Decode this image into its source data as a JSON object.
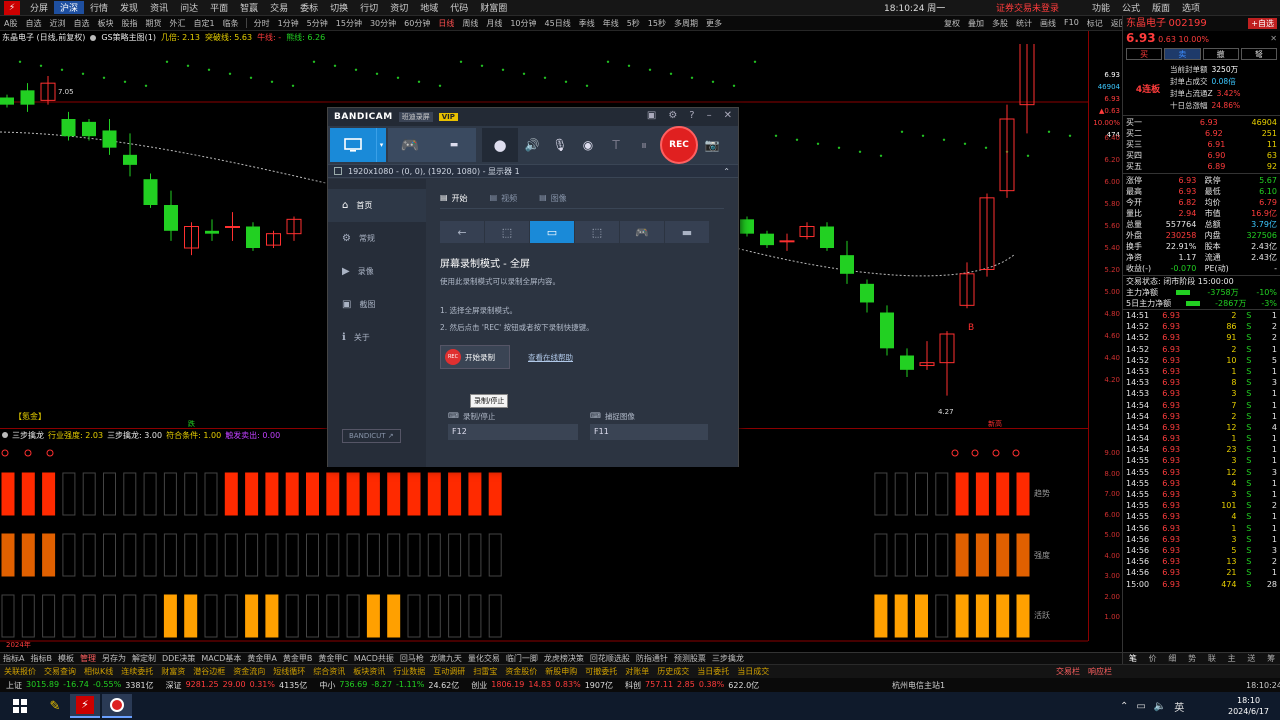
{
  "topbar": {
    "logo_icon": "app-logo-icon",
    "menu": [
      "分屏",
      "沪深",
      "行情",
      "发现",
      "资讯",
      "问达",
      "平面",
      "智赢",
      "交易",
      "委标",
      "切换",
      "行切",
      "资切",
      "地域",
      "代码",
      "财富圈"
    ],
    "active_menu": "沪深",
    "clock": "18:10:24 周一",
    "right_text": "证券交易未登录",
    "right_menu": [
      "功能",
      "公式",
      "版面",
      "选项"
    ]
  },
  "toolbar2": {
    "left": [
      "A股",
      "自选",
      "近浏",
      "自选",
      "板块",
      "股指",
      "期货",
      "外汇",
      "自定1",
      "临条"
    ],
    "periods": [
      "分时",
      "1分钟",
      "5分钟",
      "15分钟",
      "30分钟",
      "60分钟",
      "日线",
      "周线",
      "月线",
      "10分钟",
      "45日线",
      "季线",
      "年线",
      "5秒",
      "15秒",
      "多周期",
      "更多"
    ],
    "active_period": "日线",
    "right": [
      "复权",
      "叠加",
      "多股",
      "统计",
      "画线",
      "F10",
      "标记",
      "返回"
    ]
  },
  "chart_info": {
    "title": "东晶电子 (日线,前复权)",
    "indicator_name": "GS策略主图(1)",
    "items": [
      {
        "label": "几倍: 2.13",
        "color": "#e8d000"
      },
      {
        "label": "突破线: 5.63",
        "color": "#e8d000"
      },
      {
        "label": "牛线: -",
        "color": "#ff3c3c"
      },
      {
        "label": "熊线: 6.26",
        "color": "#22d022"
      }
    ]
  },
  "chart_labels": {
    "high_label": "7.05",
    "low_label": "4.27",
    "signal_b": "B",
    "box_label": "【氪金】",
    "break_label": "跌",
    "new_high_label": "新高"
  },
  "right_axis": {
    "top": [
      "6.93",
      "46904",
      "6.93",
      "▲0.63",
      "10.00%",
      "474"
    ],
    "ticks": [
      "6.40",
      "6.20",
      "6.00",
      "5.80",
      "5.60",
      "5.40",
      "5.20",
      "5.00",
      "4.80",
      "4.60",
      "4.40",
      "4.20"
    ],
    "lower": [
      "9.00",
      "8.00",
      "7.00",
      "6.00",
      "5.00",
      "4.00",
      "3.00",
      "2.00",
      "1.00"
    ]
  },
  "indicator_bar": {
    "name": "三步擒龙",
    "items": [
      {
        "label": "行业强度: 2.03",
        "color": "#e8d000"
      },
      {
        "label": "三步擒龙: 3.00",
        "color": "#e6e6e6"
      },
      {
        "label": "符合条件: 1.00",
        "color": "#e8d000"
      },
      {
        "label": "触发卖出: 0.00",
        "color": "#c040ff"
      }
    ]
  },
  "lower_labels": {
    "trend": "趋势",
    "strength": "强度",
    "active": "活跃",
    "year": "2024年"
  },
  "panel": {
    "name": "东晶电子",
    "code": "002199",
    "add_btn": "+自选",
    "price": "6.93",
    "change": "0.63",
    "pct": "10.00%",
    "buttons": [
      "买",
      "卖",
      "撤",
      "弩"
    ],
    "limit_label": "4连板",
    "limit_info": [
      [
        "当前封单额",
        "3250万"
      ],
      [
        "封单占成交",
        "0.08倍"
      ],
      [
        "封单占流通Z",
        "3.42%"
      ],
      [
        "十日总涨幅",
        "24.86%"
      ]
    ],
    "sell_orders": [
      [
        "买一",
        "6.93",
        "46904"
      ],
      [
        "买二",
        "6.92",
        "251"
      ],
      [
        "买三",
        "6.91",
        "11"
      ],
      [
        "买四",
        "6.90",
        "63"
      ],
      [
        "买五",
        "6.89",
        "92"
      ]
    ],
    "stats": [
      [
        "涨停",
        "6.93",
        "跌停",
        "5.67"
      ],
      [
        "最高",
        "6.93",
        "最低",
        "6.10"
      ],
      [
        "今开",
        "6.82",
        "均价",
        "6.79"
      ],
      [
        "量比",
        "2.94",
        "市值",
        "16.9亿"
      ],
      [
        "总量",
        "557764",
        "总额",
        "3.79亿"
      ],
      [
        "外盘",
        "230258",
        "内盘",
        "327506"
      ],
      [
        "换手",
        "22.91%",
        "股本",
        "2.43亿"
      ],
      [
        "净资",
        "1.17",
        "流通",
        "2.43亿"
      ],
      [
        "收益(-)",
        "-0.070",
        "PE(动)",
        "-"
      ]
    ],
    "trade_state": "交易状态: 闭市阶段 15:00:00",
    "flows": [
      {
        "label": "主力净额",
        "value": "-3758万",
        "pct": "-10%"
      },
      {
        "label": "5日主力净额",
        "value": "-2867万",
        "pct": "-3%"
      }
    ],
    "ticks": [
      [
        "14:51",
        "6.93",
        "2",
        "S",
        "1"
      ],
      [
        "14:52",
        "6.93",
        "86",
        "S",
        "2"
      ],
      [
        "14:52",
        "6.93",
        "91",
        "S",
        "2"
      ],
      [
        "14:52",
        "6.93",
        "2",
        "S",
        "1"
      ],
      [
        "14:52",
        "6.93",
        "10",
        "S",
        "5"
      ],
      [
        "14:53",
        "6.93",
        "1",
        "S",
        "1"
      ],
      [
        "14:53",
        "6.93",
        "8",
        "S",
        "3"
      ],
      [
        "14:53",
        "6.93",
        "3",
        "S",
        "1"
      ],
      [
        "14:54",
        "6.93",
        "7",
        "S",
        "1"
      ],
      [
        "14:54",
        "6.93",
        "2",
        "S",
        "1"
      ],
      [
        "14:54",
        "6.93",
        "12",
        "S",
        "4"
      ],
      [
        "14:54",
        "6.93",
        "1",
        "S",
        "1"
      ],
      [
        "14:54",
        "6.93",
        "23",
        "S",
        "1"
      ],
      [
        "14:55",
        "6.93",
        "3",
        "S",
        "1"
      ],
      [
        "14:55",
        "6.93",
        "12",
        "S",
        "3"
      ],
      [
        "14:55",
        "6.93",
        "4",
        "S",
        "1"
      ],
      [
        "14:55",
        "6.93",
        "3",
        "S",
        "1"
      ],
      [
        "14:55",
        "6.93",
        "101",
        "S",
        "2"
      ],
      [
        "14:55",
        "6.93",
        "4",
        "S",
        "1"
      ],
      [
        "14:56",
        "6.93",
        "1",
        "S",
        "1"
      ],
      [
        "14:56",
        "6.93",
        "3",
        "S",
        "1"
      ],
      [
        "14:56",
        "6.93",
        "5",
        "S",
        "3"
      ],
      [
        "14:56",
        "6.93",
        "13",
        "S",
        "2"
      ],
      [
        "14:56",
        "6.93",
        "21",
        "S",
        "1"
      ],
      [
        "15:00",
        "6.93",
        "474",
        "S",
        "28"
      ]
    ],
    "bottom_tabs": [
      "笔",
      "价",
      "细",
      "势",
      "联",
      "主",
      "送",
      "筹"
    ]
  },
  "bottom1": [
    "指标A",
    "指标B",
    "模板",
    "管理",
    "另存为",
    "解定制",
    "DDE决策",
    "MACD基本",
    "黄金甲A",
    "黄金甲B",
    "黄金甲C",
    "MACD共振",
    "回马枪",
    "龙啸九天",
    "量化交易",
    "临门一脚",
    "龙虎榜决策",
    "回花顺选股",
    "防指通针",
    "预测股票",
    "三步擒龙"
  ],
  "bottom2": [
    "关联报价",
    "交易查询",
    "相似K线",
    "连续委托",
    "财富资",
    "潜谷边框",
    "资金流向",
    "短线循环",
    "综合资讯",
    "板块资讯",
    "行业数据",
    "互动调研",
    "扫雷宝",
    "资金股价",
    "新股申购",
    "可撤委托",
    "对账单",
    "历史成交",
    "当日委托",
    "当日成交"
  ],
  "bottom2_right": [
    "交易栏",
    "响应栏"
  ],
  "bottom3": [
    {
      "label": "上证",
      "value": "3015.89",
      "chg": "-16.74",
      "pct": "-0.55%",
      "amt": "3381亿"
    },
    {
      "label": "深证",
      "value": "9281.25",
      "chg": "29.00",
      "pct": "0.31%",
      "amt": "4135亿"
    },
    {
      "label": "中小",
      "value": "736.69",
      "chg": "-8.27",
      "pct": "-1.11%",
      "amt": "24.62亿"
    },
    {
      "label": "创业",
      "value": "1806.19",
      "chg": "14.83",
      "pct": "0.83%",
      "amt": "1907亿"
    },
    {
      "label": "科创",
      "value": "757.11",
      "chg": "2.85",
      "pct": "0.38%",
      "amt": "622.0亿"
    }
  ],
  "bottom3_right": {
    "server": "杭州电信主站1",
    "time": "18:10:24"
  },
  "taskbar": {
    "time": "18:10",
    "date": "2024/6/17",
    "lang": "英"
  },
  "bandicam": {
    "brand": "BANDICAM",
    "sub": "班迪录屏",
    "vip": "VIP",
    "rec": "REC",
    "selection": "1920x1080 - (0, 0), (1920, 1080) - 显示器 1",
    "side": [
      "首页",
      "常规",
      "录像",
      "截图",
      "关于"
    ],
    "bandicut": "BANDICUT ↗",
    "tabs": [
      "开始",
      "视频",
      "图像"
    ],
    "mode_title": "屏幕录制模式 - 全屏",
    "mode_desc": "使用此录制模式可以录制全屏内容。",
    "step1": "1. 选择全屏录制模式。",
    "step2": "2. 然后点击 'REC' 按钮或者按下录制快捷键。",
    "start_btn": "开始录制",
    "help_link": "查看在线帮助",
    "tooltip": "录制/停止",
    "hotkey1_label": "录制/停止",
    "hotkey1": "F12",
    "hotkey2_label": "捕捉图像",
    "hotkey2": "F11"
  },
  "chart_data": {
    "type": "candlestick",
    "title": "东晶电子 (日线,前复权)",
    "ylim": [
      4.1,
      6.5
    ],
    "candles_left": [
      {
        "o": 6.35,
        "c": 6.3,
        "h": 6.37,
        "l": 6.28
      },
      {
        "o": 6.4,
        "c": 6.3,
        "h": 6.45,
        "l": 6.25
      },
      {
        "o": 6.33,
        "c": 6.45,
        "h": 6.5,
        "l": 6.3
      },
      {
        "o": 6.2,
        "c": 6.08,
        "h": 6.25,
        "l": 6.05
      },
      {
        "o": 6.18,
        "c": 6.08,
        "h": 6.2,
        "l": 6.05
      },
      {
        "o": 6.12,
        "c": 6.0,
        "h": 6.2,
        "l": 5.95
      },
      {
        "o": 5.95,
        "c": 5.88,
        "h": 6.1,
        "l": 5.8
      },
      {
        "o": 5.78,
        "c": 5.6,
        "h": 5.82,
        "l": 5.58
      },
      {
        "o": 5.6,
        "c": 5.42,
        "h": 5.7,
        "l": 5.35
      },
      {
        "o": 5.3,
        "c": 5.45,
        "h": 5.48,
        "l": 5.25
      },
      {
        "o": 5.42,
        "c": 5.4,
        "h": 5.5,
        "l": 5.35
      },
      {
        "o": 5.45,
        "c": 5.45,
        "h": 5.55,
        "l": 5.35
      },
      {
        "o": 5.45,
        "c": 5.3,
        "h": 5.48,
        "l": 5.28
      },
      {
        "o": 5.32,
        "c": 5.4,
        "h": 5.42,
        "l": 5.3
      },
      {
        "o": 5.4,
        "c": 5.5,
        "h": 5.52,
        "l": 5.35
      }
    ],
    "candles_right": [
      {
        "o": 5.5,
        "c": 5.4,
        "h": 5.52,
        "l": 5.38
      },
      {
        "o": 5.4,
        "c": 5.32,
        "h": 5.42,
        "l": 5.3
      },
      {
        "o": 5.35,
        "c": 5.35,
        "h": 5.4,
        "l": 5.28
      },
      {
        "o": 5.38,
        "c": 5.45,
        "h": 5.48,
        "l": 5.36
      },
      {
        "o": 5.45,
        "c": 5.3,
        "h": 5.48,
        "l": 5.28
      },
      {
        "o": 5.25,
        "c": 5.12,
        "h": 5.35,
        "l": 5.05
      },
      {
        "o": 5.05,
        "c": 4.92,
        "h": 5.08,
        "l": 4.85
      },
      {
        "o": 4.85,
        "c": 4.6,
        "h": 4.9,
        "l": 4.55
      },
      {
        "o": 4.55,
        "c": 4.45,
        "h": 4.6,
        "l": 4.4
      },
      {
        "o": 4.48,
        "c": 4.5,
        "h": 4.65,
        "l": 4.45
      },
      {
        "o": 4.5,
        "c": 4.7,
        "h": 4.72,
        "l": 4.27
      },
      {
        "o": 4.9,
        "c": 5.12,
        "h": 5.2,
        "l": 4.88
      },
      {
        "o": 5.15,
        "c": 5.65,
        "h": 5.68,
        "l": 5.1
      },
      {
        "o": 5.7,
        "c": 6.2,
        "h": 6.3,
        "l": 5.65
      },
      {
        "o": 6.3,
        "c": 6.93,
        "h": 6.93,
        "l": 6.1
      }
    ]
  }
}
